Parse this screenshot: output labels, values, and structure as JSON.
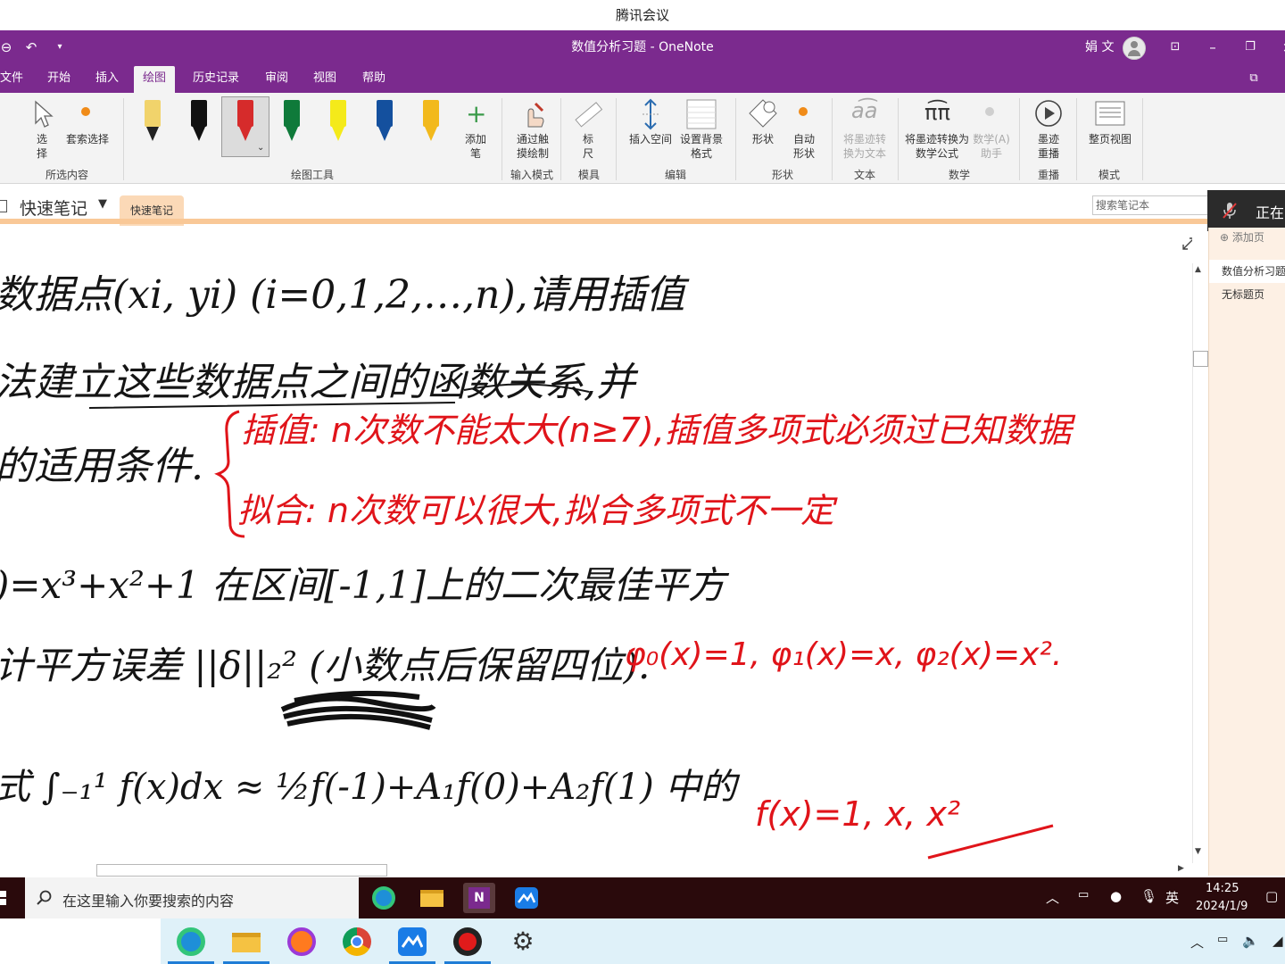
{
  "outer_window": {
    "title": "腾讯会议"
  },
  "titlebar": {
    "title": "数值分析习题 - OneNote",
    "user": "娟 文"
  },
  "menu": {
    "tabs": [
      "文件",
      "开始",
      "插入",
      "绘图",
      "历史记录",
      "审阅",
      "视图",
      "帮助"
    ],
    "active": "绘图"
  },
  "ribbon": {
    "select": "选择",
    "lasso": "套索选择",
    "group_selection": "所选内容",
    "group_tools": "绘图工具",
    "add_pen": "添加笔",
    "touch_draw": "通过触摸绘制",
    "group_input": "输入模式",
    "ruler": "标尺",
    "group_ruler": "模具",
    "insert_space": "插入空间",
    "bg_format": "设置背景格式",
    "group_edit": "编辑",
    "shapes": "形状",
    "auto_shape": "自动形状",
    "group_shapes": "形状",
    "ink_to_text": "将墨迹转换为文本",
    "group_text": "文本",
    "ink_to_math": "将墨迹转换为数学公式",
    "math_assist": "数学(A)助手",
    "group_math": "数学",
    "ink_replay": "墨迹重播",
    "group_replay": "重播",
    "page_view": "整页视图",
    "group_mode": "模式",
    "pen_colors": [
      "#f1d36b",
      "#111111",
      "#d62b2b",
      "#0f7a3a",
      "#f4ea1a",
      "#14509e",
      "#f2b91c"
    ]
  },
  "notebook": {
    "name": "快速笔记",
    "section": "快速笔记",
    "search_placeholder": "搜索笔记本"
  },
  "mic_tile": {
    "text": "正在"
  },
  "pages": {
    "add_page": "添加页",
    "items": [
      "数值分析习题",
      "无标题页"
    ],
    "selected": 0
  },
  "taskbar": {
    "search_placeholder": "在这里输入你要搜索的内容",
    "time": "14:25",
    "date": "2024/1/9",
    "ime": "英"
  },
  "ink": {
    "black_lines": [
      "数据点(xi, yi) (i=0,1,2,…,n),请用插值",
      "法建立这些数据点之间的函数关系,并",
      "的适用条件.",
      ")=x³+x²+1 在区间[-1,1]上的二次最佳平方",
      "计平方误差 ||δ||₂² (小数点后保留四位).",
      "式 ∫₋₁¹ f(x)dx ≈ ½f(-1)+A₁f(0)+A₂f(1) 中的"
    ],
    "red_lines": [
      "插值: n次数不能太大(n≥7),插值多项式必须过已知数据",
      "拟合: n次数可以很大,拟合多项式不一定",
      "φ₀(x)=1, φ₁(x)=x, φ₂(x)=x².",
      "f(x)=1, x, x²"
    ]
  }
}
